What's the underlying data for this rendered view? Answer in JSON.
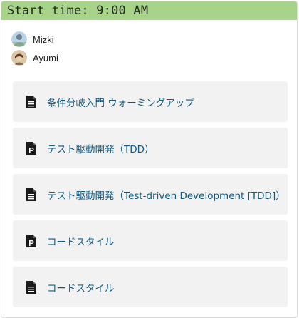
{
  "header": {
    "label": "Start time: 9:00 AM",
    "color": "#a7d48a"
  },
  "participants": [
    {
      "name": "Mizki",
      "avatar_icon": "avatar-photo"
    },
    {
      "name": "Ayumi",
      "avatar_icon": "avatar-photo"
    }
  ],
  "items": [
    {
      "label": "条件分岐入門 ウォーミングアップ",
      "icon": "document-icon"
    },
    {
      "label": "テスト駆動開発（TDD）",
      "icon": "presentation-icon"
    },
    {
      "label": "テスト駆動開発（Test-driven Development [TDD]）",
      "icon": "document-icon"
    },
    {
      "label": "コードスタイル",
      "icon": "presentation-icon"
    },
    {
      "label": "コードスタイル",
      "icon": "document-icon"
    }
  ],
  "colors": {
    "link": "#0f5a82",
    "item_background": "#f2f2f2"
  }
}
